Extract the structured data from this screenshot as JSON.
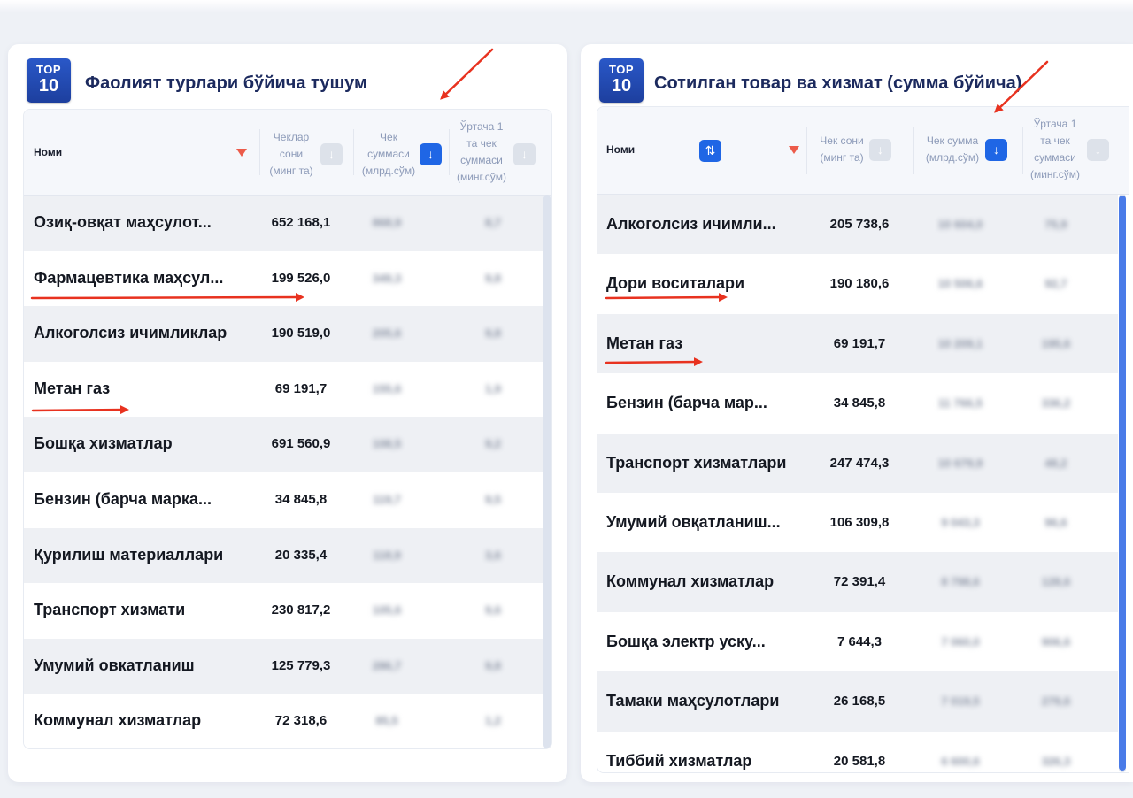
{
  "badge": {
    "line1": "TOP",
    "line2": "10"
  },
  "left": {
    "title": "Фаолият турлари бўйича тушум",
    "headers": {
      "name": "Номи",
      "count": [
        "Чеклар",
        "сони",
        "(минг та)"
      ],
      "sum": [
        "Чек",
        "суммаси",
        "(млрд.сўм)"
      ],
      "avg": [
        "Ўртача 1",
        "та чек",
        "суммаси",
        "(минг.сўм)"
      ]
    },
    "rows": [
      {
        "name": "Озиқ-овқат маҳсулот...",
        "count": "652 168,1",
        "sum": "868,9",
        "avg": "8,7"
      },
      {
        "name": "Фармацевтика маҳсул...",
        "count": "199 526,0",
        "sum": "349,3",
        "avg": "9,8"
      },
      {
        "name": "Алкоголсиз ичимликлар",
        "count": "190 519,0",
        "sum": "205,6",
        "avg": "9,8"
      },
      {
        "name": "Метан газ",
        "count": "69 191,7",
        "sum": "155,6",
        "avg": "1,9"
      },
      {
        "name": "Бошқа хизматлар",
        "count": "691 560,9",
        "sum": "108,5",
        "avg": "9,2"
      },
      {
        "name": "Бензин (барча марка...",
        "count": "34 845,8",
        "sum": "119,7",
        "avg": "9,5"
      },
      {
        "name": "Қурилиш материаллари",
        "count": "20 335,4",
        "sum": "118,9",
        "avg": "3,6"
      },
      {
        "name": "Транспорт хизмати",
        "count": "230 817,2",
        "sum": "105,6",
        "avg": "9,6"
      },
      {
        "name": "Умумий овкатланиш",
        "count": "125 779,3",
        "sum": "286,7",
        "avg": "9,8"
      },
      {
        "name": "Коммунал хизматлар",
        "count": "72 318,6",
        "sum": "85,5",
        "avg": "1,2"
      }
    ]
  },
  "right": {
    "title": "Сотилган товар ва хизмат (сумма бўйича)",
    "headers": {
      "name": "Номи",
      "count": [
        "Чек сони",
        "(минг та)"
      ],
      "sum": [
        "Чек сумма",
        "(млрд.сўм)"
      ],
      "avg": [
        "Ўртача 1",
        "та чек",
        "суммаси",
        "(минг.сўм)"
      ]
    },
    "rows": [
      {
        "name": "Алкоголсиз ичимли...",
        "count": "205 738,6",
        "sum": "10 604,0",
        "avg": "75,9"
      },
      {
        "name": "Дори воситалари",
        "count": "190 180,6",
        "sum": "10 506,6",
        "avg": "92,7"
      },
      {
        "name": "Метан газ",
        "count": "69 191,7",
        "sum": "10 209,1",
        "avg": "195,6"
      },
      {
        "name": "Бензин (барча мар...",
        "count": "34 845,8",
        "sum": "11 766,5",
        "avg": "336,2"
      },
      {
        "name": "Транспорт хизматлари",
        "count": "247 474,3",
        "sum": "10 679,9",
        "avg": "48,2"
      },
      {
        "name": "Умумий овқатланиш...",
        "count": "106 309,8",
        "sum": "9 043,3",
        "avg": "96,6"
      },
      {
        "name": "Коммунал хизматлар",
        "count": "72 391,4",
        "sum": "8 798,6",
        "avg": "128,6"
      },
      {
        "name": "Бошқа электр ускy...",
        "count": "7 644,3",
        "sum": "7 060,0",
        "avg": "906,6"
      },
      {
        "name": "Тамаки маҳсулотлари",
        "count": "26 168,5",
        "sum": "7 019,5",
        "avg": "279,6"
      },
      {
        "name": "Тиббий хизматлар",
        "count": "20 581,8",
        "sum": "6 600,6",
        "avg": "326,3"
      }
    ]
  },
  "icons": {
    "sort_down": "arrow-down-icon",
    "sort_both": "sort-up-down-icon",
    "filter": "triangle-down-icon"
  },
  "colors": {
    "accent": "#1f66e5",
    "title": "#1c2a5e",
    "annotation": "#e8321f"
  }
}
